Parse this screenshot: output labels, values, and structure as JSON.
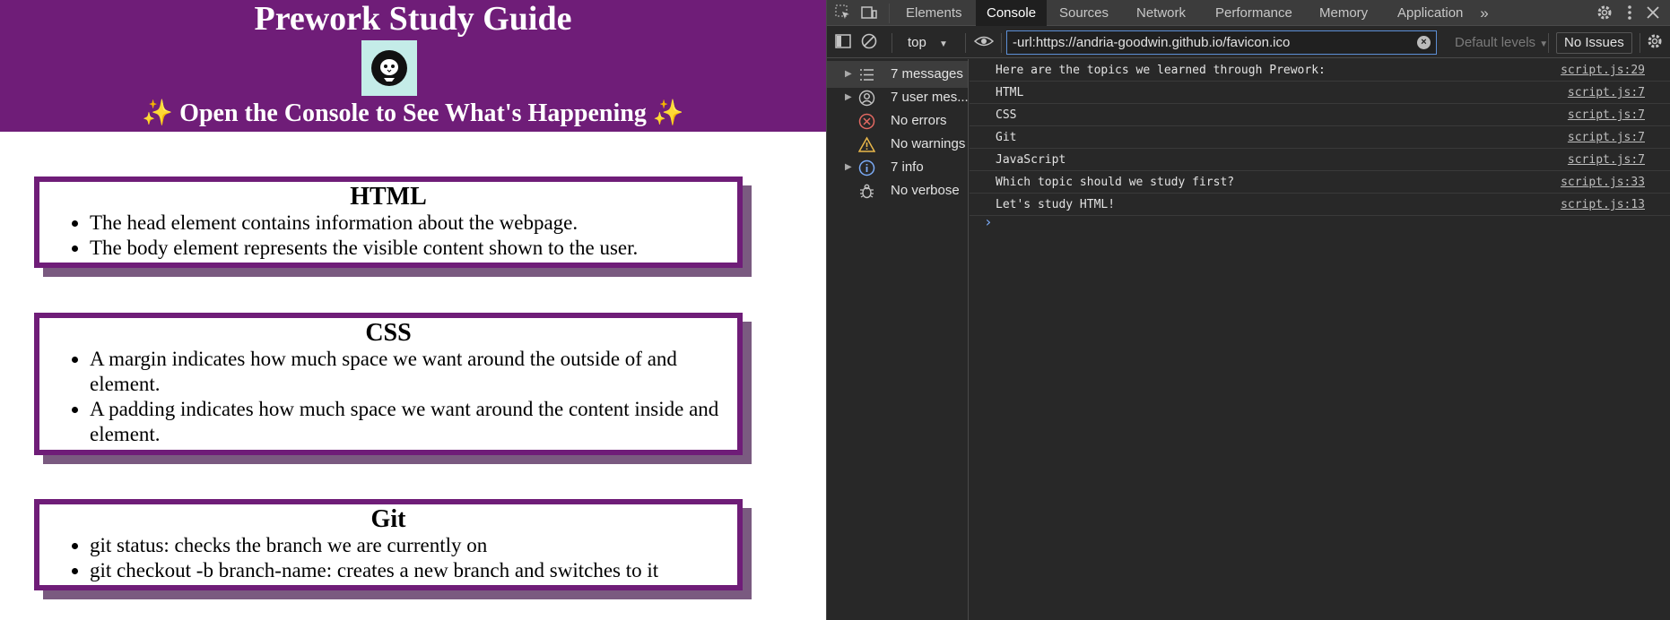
{
  "page": {
    "title": "Prework Study Guide",
    "subtitle": "✨ Open the Console to See What's Happening ✨",
    "sections": [
      {
        "heading": "HTML",
        "items": [
          "The head element contains information about the webpage.",
          "The body element represents the visible content shown to the user."
        ]
      },
      {
        "heading": "CSS",
        "items": [
          "A margin indicates how much space we want around the outside of and element.",
          "A padding indicates how much space we want around the content inside and element."
        ]
      },
      {
        "heading": "Git",
        "items": [
          "git status: checks the branch we are currently on",
          "git checkout -b branch-name: creates a new branch and switches to it"
        ]
      }
    ]
  },
  "devtools": {
    "tabs": [
      "Elements",
      "Console",
      "Sources",
      "Network",
      "Performance",
      "Memory",
      "Application"
    ],
    "active_tab": "Console",
    "more_tabs_icon": "chevron-double-right-icon",
    "context": "top",
    "filter_value": "-url:https://andria-goodwin.github.io/favicon.ico",
    "levels": "Default levels",
    "issues": "No Issues",
    "sidebar": [
      {
        "label": "7 messages",
        "icon": "list-icon",
        "expandable": true
      },
      {
        "label": "7 user mes...",
        "icon": "user-icon",
        "expandable": true
      },
      {
        "label": "No errors",
        "icon": "error-icon",
        "expandable": false
      },
      {
        "label": "No warnings",
        "icon": "warning-icon",
        "expandable": false
      },
      {
        "label": "7 info",
        "icon": "info-icon",
        "expandable": true
      },
      {
        "label": "No verbose",
        "icon": "bug-icon",
        "expandable": false
      }
    ],
    "messages": [
      {
        "text": "Here are the topics we learned through Prework:",
        "source": "script.js:29"
      },
      {
        "text": "HTML",
        "source": "script.js:7"
      },
      {
        "text": "CSS",
        "source": "script.js:7"
      },
      {
        "text": "Git",
        "source": "script.js:7"
      },
      {
        "text": "JavaScript",
        "source": "script.js:7"
      },
      {
        "text": "Which topic should we study first?",
        "source": "script.js:33"
      },
      {
        "text": "Let's study HTML!",
        "source": "script.js:13"
      }
    ]
  },
  "colors": {
    "brand_purple": "#6f1d78",
    "card_shadow": "#7a5a80",
    "logo_bg": "#c4ece8",
    "devtools_bg": "#282828",
    "error_red": "#e46962",
    "warning_yellow": "#e9b74a",
    "info_blue": "#7cacf8"
  }
}
